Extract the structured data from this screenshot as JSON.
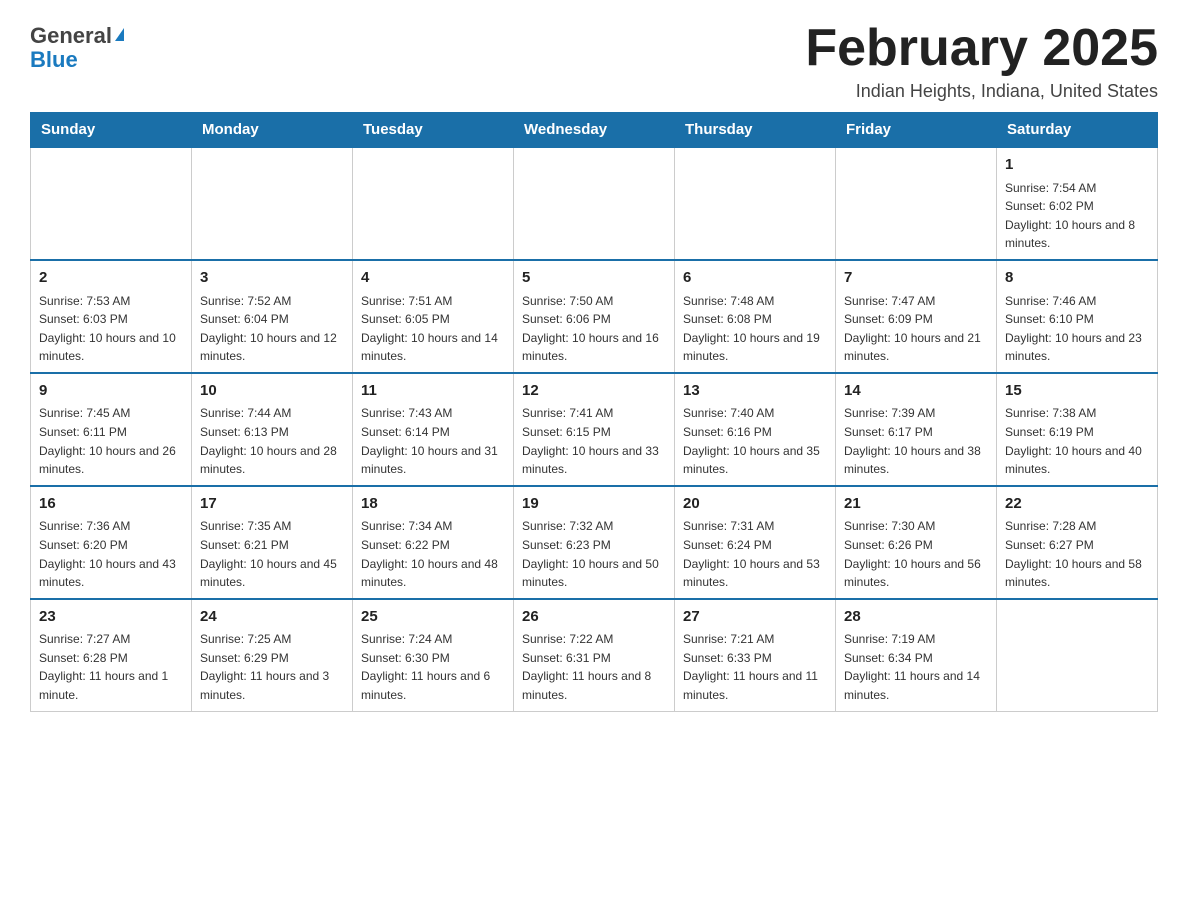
{
  "header": {
    "logo_general": "General",
    "logo_blue": "Blue",
    "month_title": "February 2025",
    "location": "Indian Heights, Indiana, United States"
  },
  "weekdays": [
    "Sunday",
    "Monday",
    "Tuesday",
    "Wednesday",
    "Thursday",
    "Friday",
    "Saturday"
  ],
  "weeks": [
    [
      {
        "day": "",
        "info": ""
      },
      {
        "day": "",
        "info": ""
      },
      {
        "day": "",
        "info": ""
      },
      {
        "day": "",
        "info": ""
      },
      {
        "day": "",
        "info": ""
      },
      {
        "day": "",
        "info": ""
      },
      {
        "day": "1",
        "info": "Sunrise: 7:54 AM\nSunset: 6:02 PM\nDaylight: 10 hours and 8 minutes."
      }
    ],
    [
      {
        "day": "2",
        "info": "Sunrise: 7:53 AM\nSunset: 6:03 PM\nDaylight: 10 hours and 10 minutes."
      },
      {
        "day": "3",
        "info": "Sunrise: 7:52 AM\nSunset: 6:04 PM\nDaylight: 10 hours and 12 minutes."
      },
      {
        "day": "4",
        "info": "Sunrise: 7:51 AM\nSunset: 6:05 PM\nDaylight: 10 hours and 14 minutes."
      },
      {
        "day": "5",
        "info": "Sunrise: 7:50 AM\nSunset: 6:06 PM\nDaylight: 10 hours and 16 minutes."
      },
      {
        "day": "6",
        "info": "Sunrise: 7:48 AM\nSunset: 6:08 PM\nDaylight: 10 hours and 19 minutes."
      },
      {
        "day": "7",
        "info": "Sunrise: 7:47 AM\nSunset: 6:09 PM\nDaylight: 10 hours and 21 minutes."
      },
      {
        "day": "8",
        "info": "Sunrise: 7:46 AM\nSunset: 6:10 PM\nDaylight: 10 hours and 23 minutes."
      }
    ],
    [
      {
        "day": "9",
        "info": "Sunrise: 7:45 AM\nSunset: 6:11 PM\nDaylight: 10 hours and 26 minutes."
      },
      {
        "day": "10",
        "info": "Sunrise: 7:44 AM\nSunset: 6:13 PM\nDaylight: 10 hours and 28 minutes."
      },
      {
        "day": "11",
        "info": "Sunrise: 7:43 AM\nSunset: 6:14 PM\nDaylight: 10 hours and 31 minutes."
      },
      {
        "day": "12",
        "info": "Sunrise: 7:41 AM\nSunset: 6:15 PM\nDaylight: 10 hours and 33 minutes."
      },
      {
        "day": "13",
        "info": "Sunrise: 7:40 AM\nSunset: 6:16 PM\nDaylight: 10 hours and 35 minutes."
      },
      {
        "day": "14",
        "info": "Sunrise: 7:39 AM\nSunset: 6:17 PM\nDaylight: 10 hours and 38 minutes."
      },
      {
        "day": "15",
        "info": "Sunrise: 7:38 AM\nSunset: 6:19 PM\nDaylight: 10 hours and 40 minutes."
      }
    ],
    [
      {
        "day": "16",
        "info": "Sunrise: 7:36 AM\nSunset: 6:20 PM\nDaylight: 10 hours and 43 minutes."
      },
      {
        "day": "17",
        "info": "Sunrise: 7:35 AM\nSunset: 6:21 PM\nDaylight: 10 hours and 45 minutes."
      },
      {
        "day": "18",
        "info": "Sunrise: 7:34 AM\nSunset: 6:22 PM\nDaylight: 10 hours and 48 minutes."
      },
      {
        "day": "19",
        "info": "Sunrise: 7:32 AM\nSunset: 6:23 PM\nDaylight: 10 hours and 50 minutes."
      },
      {
        "day": "20",
        "info": "Sunrise: 7:31 AM\nSunset: 6:24 PM\nDaylight: 10 hours and 53 minutes."
      },
      {
        "day": "21",
        "info": "Sunrise: 7:30 AM\nSunset: 6:26 PM\nDaylight: 10 hours and 56 minutes."
      },
      {
        "day": "22",
        "info": "Sunrise: 7:28 AM\nSunset: 6:27 PM\nDaylight: 10 hours and 58 minutes."
      }
    ],
    [
      {
        "day": "23",
        "info": "Sunrise: 7:27 AM\nSunset: 6:28 PM\nDaylight: 11 hours and 1 minute."
      },
      {
        "day": "24",
        "info": "Sunrise: 7:25 AM\nSunset: 6:29 PM\nDaylight: 11 hours and 3 minutes."
      },
      {
        "day": "25",
        "info": "Sunrise: 7:24 AM\nSunset: 6:30 PM\nDaylight: 11 hours and 6 minutes."
      },
      {
        "day": "26",
        "info": "Sunrise: 7:22 AM\nSunset: 6:31 PM\nDaylight: 11 hours and 8 minutes."
      },
      {
        "day": "27",
        "info": "Sunrise: 7:21 AM\nSunset: 6:33 PM\nDaylight: 11 hours and 11 minutes."
      },
      {
        "day": "28",
        "info": "Sunrise: 7:19 AM\nSunset: 6:34 PM\nDaylight: 11 hours and 14 minutes."
      },
      {
        "day": "",
        "info": ""
      }
    ]
  ]
}
